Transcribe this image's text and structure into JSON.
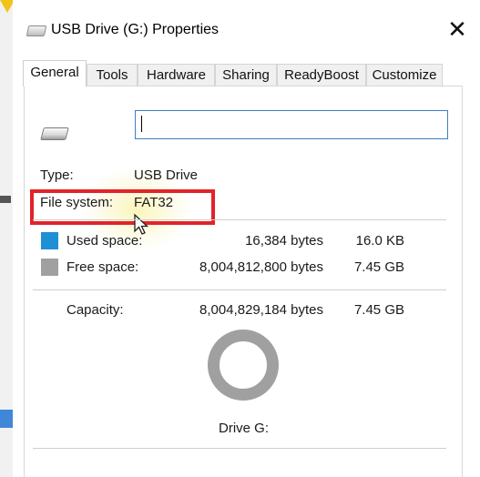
{
  "window": {
    "title": "USB Drive (G:) Properties",
    "close_glyph": "✕"
  },
  "tabs": [
    {
      "label": "General",
      "active": true
    },
    {
      "label": "Tools",
      "active": false
    },
    {
      "label": "Hardware",
      "active": false
    },
    {
      "label": "Sharing",
      "active": false
    },
    {
      "label": "ReadyBoost",
      "active": false
    },
    {
      "label": "Customize",
      "active": false
    }
  ],
  "general": {
    "volume_label_value": "",
    "type_label": "Type:",
    "type_value": "USB Drive",
    "filesystem_label": "File system:",
    "filesystem_value": "FAT32",
    "used": {
      "label": "Used space:",
      "bytes": "16,384 bytes",
      "size": "16.0 KB"
    },
    "free": {
      "label": "Free space:",
      "bytes": "8,004,812,800 bytes",
      "size": "7.45 GB"
    },
    "capacity": {
      "label": "Capacity:",
      "bytes": "8,004,829,184 bytes",
      "size": "7.45 GB"
    },
    "drive_label": "Drive G:"
  },
  "colors": {
    "used": "#1e90d6",
    "free": "#a0a0a0",
    "highlight": "#e2232a"
  },
  "icons": [
    "usb-drive-icon",
    "close-icon",
    "mouse-cursor-icon"
  ]
}
